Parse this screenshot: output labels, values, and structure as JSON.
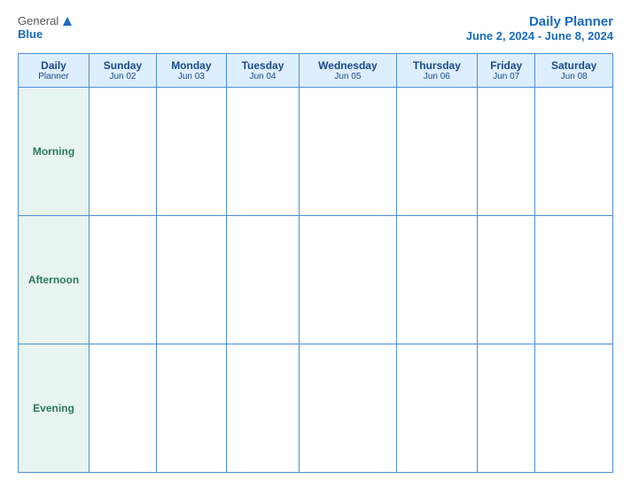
{
  "logo": {
    "general": "General",
    "blue": "Blue"
  },
  "header": {
    "title": "Daily Planner",
    "date_range": "June 2, 2024 - June 8, 2024"
  },
  "table": {
    "label_header": {
      "line1": "Daily",
      "line2": "Planner"
    },
    "days": [
      {
        "name": "Sunday",
        "date": "Jun 02"
      },
      {
        "name": "Monday",
        "date": "Jun 03"
      },
      {
        "name": "Tuesday",
        "date": "Jun 04"
      },
      {
        "name": "Wednesday",
        "date": "Jun 05"
      },
      {
        "name": "Thursday",
        "date": "Jun 06"
      },
      {
        "name": "Friday",
        "date": "Jun 07"
      },
      {
        "name": "Saturday",
        "date": "Jun 08"
      }
    ],
    "rows": [
      {
        "label": "Morning"
      },
      {
        "label": "Afternoon"
      },
      {
        "label": "Evening"
      }
    ]
  }
}
